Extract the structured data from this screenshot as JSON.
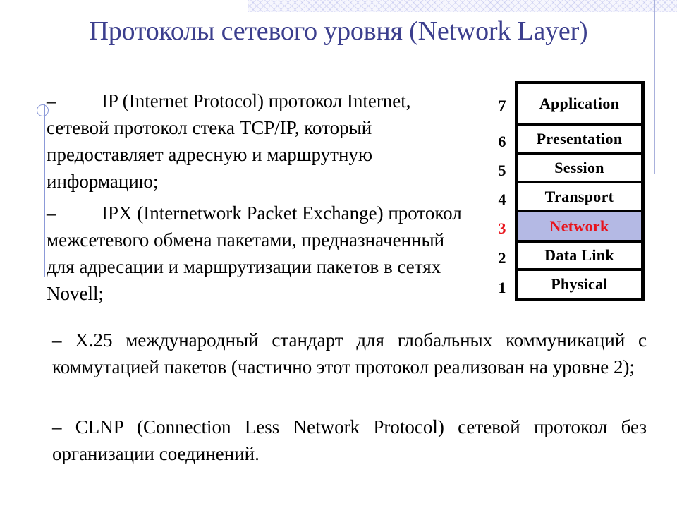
{
  "title": "Протоколы сетевого уровня (Network Layer)",
  "paragraphs": {
    "ip": {
      "dash": "–",
      "text": "IP (Internet Protocol) протокол Internet, сетевой протокол стека TCP/IP, который предоставляет адресную и маршрутную информацию;"
    },
    "ipx": {
      "dash": "–",
      "text": "IPX (Internetwork Packet Exchange) протокол межсетевого обмена пакетами, предназначенный для адресации и маршрутизации пакетов в сетях Novell;"
    },
    "x25": {
      "dash": "–",
      "text": "X.25 международный стандарт для глобальных коммуникаций с коммутацией пакетов (частично этот протокол реализован на уровне 2);"
    },
    "clnp": {
      "dash": "–",
      "text": "CLNP (Connection Less Network Protocol) сетевой протокол без организации соединений."
    }
  },
  "osi_model": {
    "highlight_color": "#b4b9e4",
    "highlight_text_color": "#e8141c",
    "layers": [
      {
        "number": "7",
        "name": "Application",
        "highlighted": false
      },
      {
        "number": "6",
        "name": "Presentation",
        "highlighted": false
      },
      {
        "number": "5",
        "name": "Session",
        "highlighted": false
      },
      {
        "number": "4",
        "name": "Transport",
        "highlighted": false
      },
      {
        "number": "3",
        "name": "Network",
        "highlighted": true
      },
      {
        "number": "2",
        "name": "Data Link",
        "highlighted": false
      },
      {
        "number": "1",
        "name": "Physical",
        "highlighted": false
      }
    ]
  }
}
